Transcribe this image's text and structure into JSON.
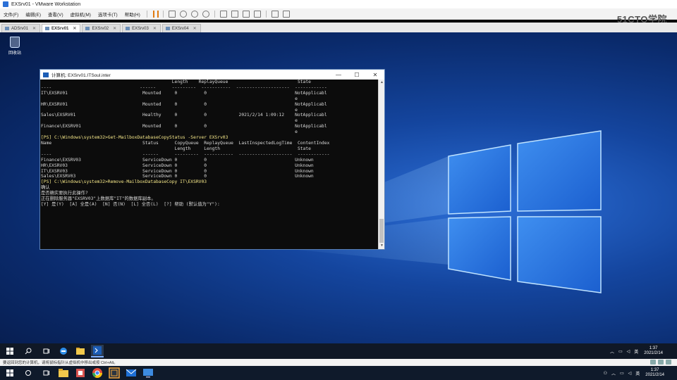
{
  "vmware": {
    "window_title": "EXSrv01 - VMware Workstation",
    "menu": [
      "文件(F)",
      "编辑(E)",
      "查看(V)",
      "虚拟机(M)",
      "选项卡(T)",
      "帮助(H)"
    ],
    "brand": "51CTO学院",
    "tabs": [
      {
        "label": "ADSrv01",
        "active": false
      },
      {
        "label": "EXSrv01",
        "active": true
      },
      {
        "label": "EXSrv02",
        "active": false
      },
      {
        "label": "EXSrv03",
        "active": false
      },
      {
        "label": "EXSrv04",
        "active": false
      }
    ],
    "status_text": "要返回到您的计算机，请将鼠标指针从虚拟机中移出或按 Ctrl+Alt。"
  },
  "desktop": {
    "recycle_bin_label": "回收站",
    "colors": {
      "bg_dark": "#061a47",
      "bg_light": "#2c6fd8"
    }
  },
  "console": {
    "title": "计算机: EXSrv01.ITSoul.inter",
    "controls": [
      "—",
      "☐",
      "✕"
    ],
    "lines": [
      {
        "text": "                                                 Length    ReplayQueue                          State",
        "kind": "out"
      },
      {
        "text": "----                                 ------      ---------  -----------  --------------------  ------------",
        "kind": "out"
      },
      {
        "text": "IT\\EXSRV01                            Mounted     0          0                                 NotApplicabl",
        "kind": "out"
      },
      {
        "text": "                                                                                               e",
        "kind": "out"
      },
      {
        "text": "HR\\EXSRV01                            Mounted     0          0                                 NotApplicabl",
        "kind": "out"
      },
      {
        "text": "                                                                                               e",
        "kind": "out"
      },
      {
        "text": "Sales\\EXSRV01                         Healthy     0          0            2021/2/14 1:09:12    NotApplicabl",
        "kind": "out"
      },
      {
        "text": "                                                                                               e",
        "kind": "out"
      },
      {
        "text": "Finance\\EXSRV01                       Mounted     0          0                                 NotApplicabl",
        "kind": "out"
      },
      {
        "text": "                                                                                               e",
        "kind": "out"
      },
      {
        "text": "",
        "kind": "out"
      },
      {
        "text": "",
        "kind": "out"
      },
      {
        "text": "",
        "kind": "out"
      },
      {
        "text": "[PS] C:\\Windows\\system32>Get-MailboxDatabaseCopyStatus -Server EXSrv03",
        "kind": "cmd"
      },
      {
        "text": "",
        "kind": "out"
      },
      {
        "text": "Name                                  Status      CopyQueue  ReplayQueue  LastInspectedLogTime  ContentIndex",
        "kind": "out"
      },
      {
        "text": "                                                  Length     Length                             State",
        "kind": "out"
      },
      {
        "text": "----                                  ------      ---------  -----------  --------------------  ------------",
        "kind": "out"
      },
      {
        "text": "Finance\\EXSRV03                       ServiceDown 0          0                                 Unknown",
        "kind": "out"
      },
      {
        "text": "HR\\EXSRV03                            ServiceDown 0          0                                 Unknown",
        "kind": "out"
      },
      {
        "text": "IT\\EXSRV03                            ServiceDown 0          0                                 Unknown",
        "kind": "out"
      },
      {
        "text": "Sales\\EXSRV03                         ServiceDown 0          0                                 Unknown",
        "kind": "out"
      },
      {
        "text": "",
        "kind": "out"
      },
      {
        "text": "",
        "kind": "out"
      },
      {
        "text": "[PS] C:\\Windows\\system32>Remove-MailboxDatabaseCopy IT\\EXSRV03",
        "kind": "cmd"
      },
      {
        "text": "",
        "kind": "out"
      },
      {
        "text": "确认",
        "kind": "out"
      },
      {
        "text": "是否确实要执行此操作?",
        "kind": "out"
      },
      {
        "text": "正在删除服务器\"EXSRV03\"上数据库\"IT\"的数据库副本。",
        "kind": "out"
      },
      {
        "text": "[Y] 是(Y)  [A] 全是(A)  [N] 否(N)  [L] 全否(L)  [?] 帮助 (默认值为\"Y\"):",
        "kind": "out"
      }
    ]
  },
  "guest_taskbar": {
    "tray_lang": "英",
    "time": "1:37",
    "date": "2021/2/14"
  },
  "host_taskbar": {
    "tray_lang": "英",
    "time": "1:37",
    "date": "2021/2/14"
  }
}
